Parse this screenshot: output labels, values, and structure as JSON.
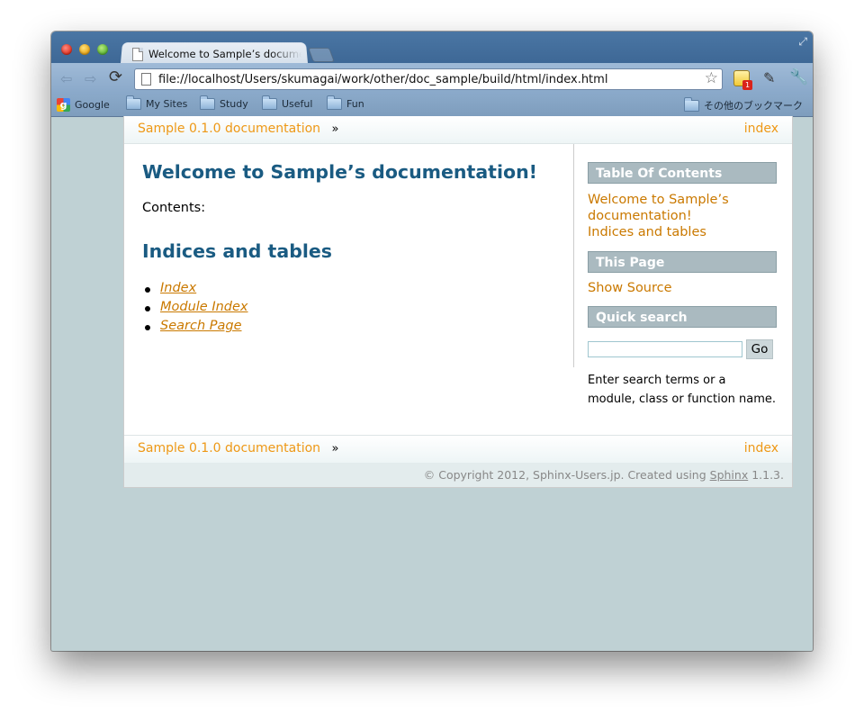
{
  "browser": {
    "tab_title": "Welcome to Sample’s documentation!",
    "url": "file://localhost/Users/skumagai/work/other/doc_sample/build/html/index.html",
    "extension_badge": "1"
  },
  "bookmarks": [
    {
      "label": "Google",
      "icon": "google-icon"
    },
    {
      "label": "My Sites",
      "icon": "folder-icon"
    },
    {
      "label": "Study",
      "icon": "folder-icon"
    },
    {
      "label": "Useful",
      "icon": "folder-icon"
    },
    {
      "label": "Fun",
      "icon": "folder-icon"
    }
  ],
  "other_bookmarks": "その他のブックマーク",
  "relbar": {
    "doc_link": "Sample 0.1.0 documentation",
    "separator": "»",
    "index_link": "index"
  },
  "content": {
    "title": "Welcome to Sample’s documentation!",
    "contents_label": "Contents:",
    "indices_heading": "Indices and tables",
    "index_items": [
      "Index",
      "Module Index",
      "Search Page"
    ]
  },
  "sidebar": {
    "toc_heading": "Table Of Contents",
    "toc_links": [
      "Welcome to Sample’s documentation!",
      "Indices and tables"
    ],
    "this_page_heading": "This Page",
    "show_source": "Show Source",
    "quick_search_heading": "Quick search",
    "search_value": "",
    "go_label": "Go",
    "search_help": "Enter search terms or a module, class or function name."
  },
  "footer": {
    "copyright": "© Copyright 2012, Sphinx-Users.jp. Created using ",
    "sphinx_link": "Sphinx",
    "version": " 1.1.3."
  },
  "colors": {
    "heading": "#1a5b82",
    "link": "#ca7900",
    "relbar_link": "#ee9816",
    "background": "#bfd1d4"
  }
}
